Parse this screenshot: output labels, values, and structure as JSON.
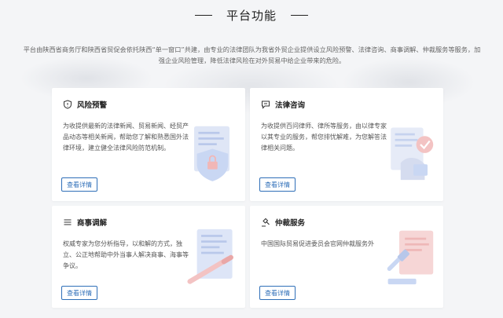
{
  "section": {
    "title": "平台功能",
    "intro": "平台由陕西省商务厅和陕西省贸促会依托陕西“单一窗口”共建，由专业的法律团队为我省外贸企业提供设立风险预警、法律咨询、商事调解、仲裁服务等服务，加强企业风险管理，降低法律风险在对外贸易中给企业带来的危险。"
  },
  "cards": [
    {
      "title": "风险预警",
      "desc": "为收提供最新的法律新闻、贸易新闻、经贸产品动态等相关新闻，帮助您了解和熟悉国外法律环境，建立健全法律风险防范机制。",
      "button": "查看详情",
      "icon": "shield-alert-icon"
    },
    {
      "title": "法律咨询",
      "desc": "为收提供百问律师、律所等服务，由以律专家以其专业的服务，帮您排忧解难，为您解答法律相关问题。",
      "button": "查看详情",
      "icon": "chat-legal-icon"
    },
    {
      "title": "商事调解",
      "desc": "权威专家为您分析指导，以和解的方式，独立、公正地帮助中外当事人解决商事、海事等争议。",
      "button": "查看详情",
      "icon": "list-icon"
    },
    {
      "title": "仲裁服务",
      "desc": "中国国际贸易促进委员会官网仲裁服务外",
      "button": "查看详情",
      "icon": "gavel-icon"
    }
  ],
  "colors": {
    "accent": "#2f6fb8",
    "illus_blue": "#c9d7f3",
    "illus_red": "#f3c3c3"
  }
}
